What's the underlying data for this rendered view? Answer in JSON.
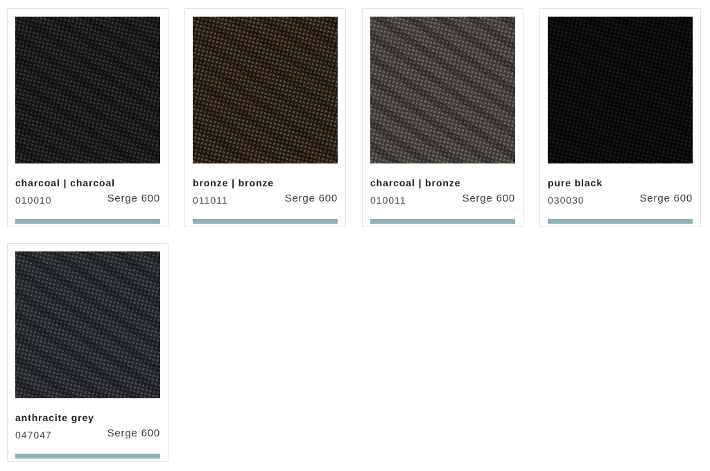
{
  "swatches": [
    {
      "name": "charcoal | charcoal",
      "code": "010010",
      "collection": "Serge 600",
      "colors": {
        "base": "#141312",
        "thread": "#2c2b29",
        "highlight": "#4a4845"
      }
    },
    {
      "name": "bronze | bronze",
      "code": "011011",
      "collection": "Serge 600",
      "colors": {
        "base": "#1f1810",
        "thread": "#4b3b28",
        "highlight": "#7a6346"
      }
    },
    {
      "name": "charcoal | bronze",
      "code": "010011",
      "collection": "Serge 600",
      "colors": {
        "base": "#3b3835",
        "thread": "#5f5a54",
        "highlight": "#7f7870"
      }
    },
    {
      "name": "pure black",
      "code": "030030",
      "collection": "Serge 600",
      "colors": {
        "base": "#050505",
        "thread": "#151515",
        "highlight": "#242424"
      }
    },
    {
      "name": "anthracite grey",
      "code": "047047",
      "collection": "Serge 600",
      "colors": {
        "base": "#202226",
        "thread": "#3a3d42",
        "highlight": "#5a5e64"
      }
    }
  ],
  "accent_bar_color": "#8fb2ba"
}
